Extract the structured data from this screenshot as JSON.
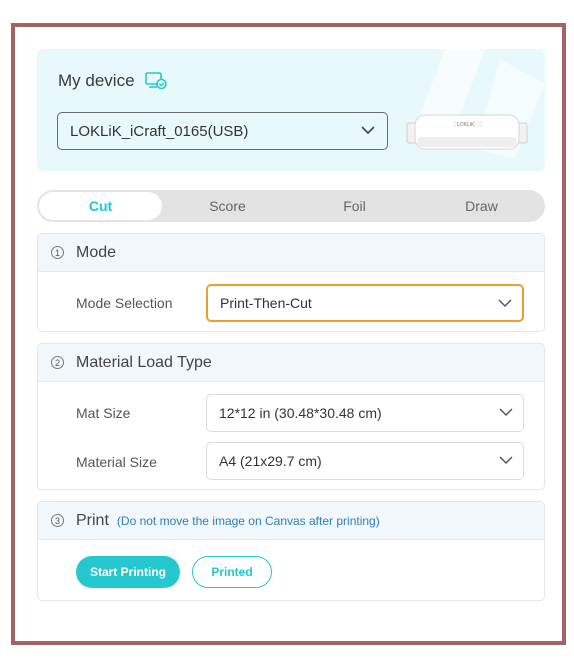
{
  "device": {
    "title": "My device",
    "selected": "LOKLiK_iCraft_0165(USB)",
    "machine_brand_text": "LOKLiK"
  },
  "tabs": [
    {
      "label": "Cut",
      "active": true
    },
    {
      "label": "Score",
      "active": false
    },
    {
      "label": "Foil",
      "active": false
    },
    {
      "label": "Draw",
      "active": false
    }
  ],
  "mode": {
    "number": "1",
    "title": "Mode",
    "row_label": "Mode Selection",
    "value": "Print-Then-Cut"
  },
  "material": {
    "number": "2",
    "title": "Material Load Type",
    "mat_label": "Mat Size",
    "mat_value": "12*12 in (30.48*30.48 cm)",
    "material_label": "Material Size",
    "material_value": "A4 (21x29.7 cm)"
  },
  "print": {
    "number": "3",
    "title": "Print",
    "note": "(Do not move the image on Canvas after printing)",
    "start_label": "Start Printing",
    "printed_label": "Printed"
  },
  "colors": {
    "accent": "#25c8cf",
    "highlight": "#ef9d2b",
    "frame": "#a4635e"
  }
}
